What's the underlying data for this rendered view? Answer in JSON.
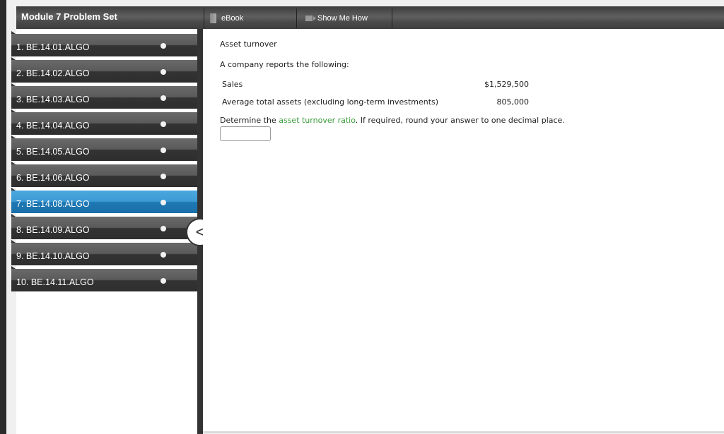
{
  "header": {
    "title": "Module 7 Problem Set",
    "tabs": [
      {
        "label": "eBook",
        "icon": "book-icon"
      },
      {
        "label": "Show Me How",
        "icon": "video-icon"
      }
    ]
  },
  "sidebar": {
    "active_index": 6,
    "items": [
      {
        "label": "1. BE.14.01.ALGO"
      },
      {
        "label": "2. BE.14.02.ALGO"
      },
      {
        "label": "3. BE.14.03.ALGO"
      },
      {
        "label": "4. BE.14.04.ALGO"
      },
      {
        "label": "5. BE.14.05.ALGO"
      },
      {
        "label": "6. BE.14.06.ALGO"
      },
      {
        "label": "7. BE.14.08.ALGO"
      },
      {
        "label": "8. BE.14.09.ALGO"
      },
      {
        "label": "9. BE.14.10.ALGO"
      },
      {
        "label": "10. BE.14.11.ALGO"
      }
    ],
    "collapse_icon": "chevron-left-icon",
    "collapse_glyph": "<"
  },
  "problem": {
    "title": "Asset turnover",
    "intro": "A company reports the following:",
    "rows": [
      {
        "label": "Sales",
        "value": "$1,529,500"
      },
      {
        "label": "Average total assets (excluding long-term investments)",
        "value": "805,000"
      }
    ],
    "question_prefix": "Determine the ",
    "question_link": "asset turnover ratio",
    "question_suffix": ". If required, round your answer to one decimal place.",
    "answer_value": ""
  },
  "colors": {
    "active_item": "#2a8bc8",
    "link": "#3a9a3a",
    "toolbar": "#4a4a4a"
  }
}
